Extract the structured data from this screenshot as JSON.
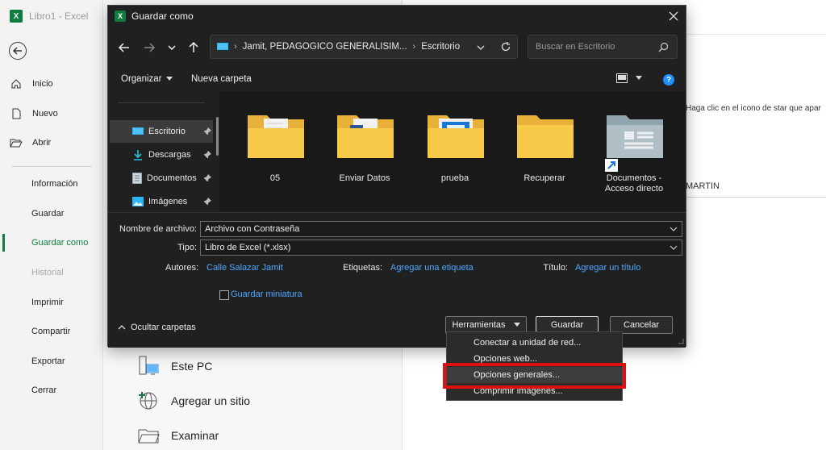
{
  "app": {
    "title": "Libro1  -  Excel",
    "logo": "X"
  },
  "backstage": {
    "nav": [
      {
        "label": "Inicio",
        "icon": "home-icon"
      },
      {
        "label": "Nuevo",
        "icon": "new-file-icon"
      },
      {
        "label": "Abrir",
        "icon": "folder-open-icon"
      },
      {
        "label": "Información"
      },
      {
        "label": "Guardar"
      },
      {
        "label": "Guardar como",
        "active": true
      },
      {
        "label": "Historial",
        "disabled": true
      },
      {
        "label": "Imprimir"
      },
      {
        "label": "Compartir"
      },
      {
        "label": "Exportar"
      },
      {
        "label": "Cerrar"
      }
    ],
    "locations": [
      {
        "label": "Este PC",
        "icon": "pc-icon"
      },
      {
        "label": "Agregar un sitio",
        "icon": "globe-add-icon"
      },
      {
        "label": "Examinar",
        "icon": "folder-icon"
      }
    ],
    "hint": "Haga clic en el icono de star que apar",
    "list_item": "MARTIN"
  },
  "dialog": {
    "title": "Guardar como",
    "address": {
      "path": "Jamit, PEDAGOGICO GENERALISIM...",
      "folder": "Escritorio"
    },
    "search_placeholder": "Buscar en Escritorio",
    "toolbar": {
      "organize": "Organizar",
      "new_folder": "Nueva carpeta",
      "help": "?"
    },
    "nav_pane": [
      {
        "label": "Escritorio",
        "icon": "desktop-icon",
        "selected": true
      },
      {
        "label": "Descargas",
        "icon": "download-icon"
      },
      {
        "label": "Documentos",
        "icon": "documents-icon"
      },
      {
        "label": "Imágenes",
        "icon": "pictures-icon"
      }
    ],
    "files": [
      {
        "name": "05",
        "icon": "folder-doc-icon"
      },
      {
        "name": "Enviar Datos",
        "icon": "folder-word-icon"
      },
      {
        "name": "prueba",
        "icon": "folder-image-icon"
      },
      {
        "name": "Recuperar",
        "icon": "folder-icon"
      },
      {
        "name": "Documentos -",
        "name2": "Acceso directo",
        "icon": "documents-shortcut-icon"
      }
    ],
    "form": {
      "filename_label": "Nombre de archivo:",
      "filename_value": "Archivo con Contraseña",
      "type_label": "Tipo:",
      "type_value": "Libro de Excel (*.xlsx)",
      "authors_label": "Autores:",
      "authors_value": "Calle Salazar Jamit",
      "tags_label": "Etiquetas:",
      "tags_value": "Agregar una etiqueta",
      "title_label": "Título:",
      "title_value": "Agregar un título",
      "thumbnail_label": "Guardar miniatura"
    },
    "footer": {
      "hide_folders": "Ocultar carpetas",
      "tools": "Herramientas",
      "save": "Guardar",
      "cancel": "Cancelar"
    },
    "tools_menu": [
      "Conectar a unidad de red...",
      "Opciones web...",
      "Opciones generales...",
      "Comprimir imágenes..."
    ]
  },
  "colors": {
    "accent": "#107c41",
    "link": "#4ea8ff",
    "highlight": "#e01010"
  }
}
